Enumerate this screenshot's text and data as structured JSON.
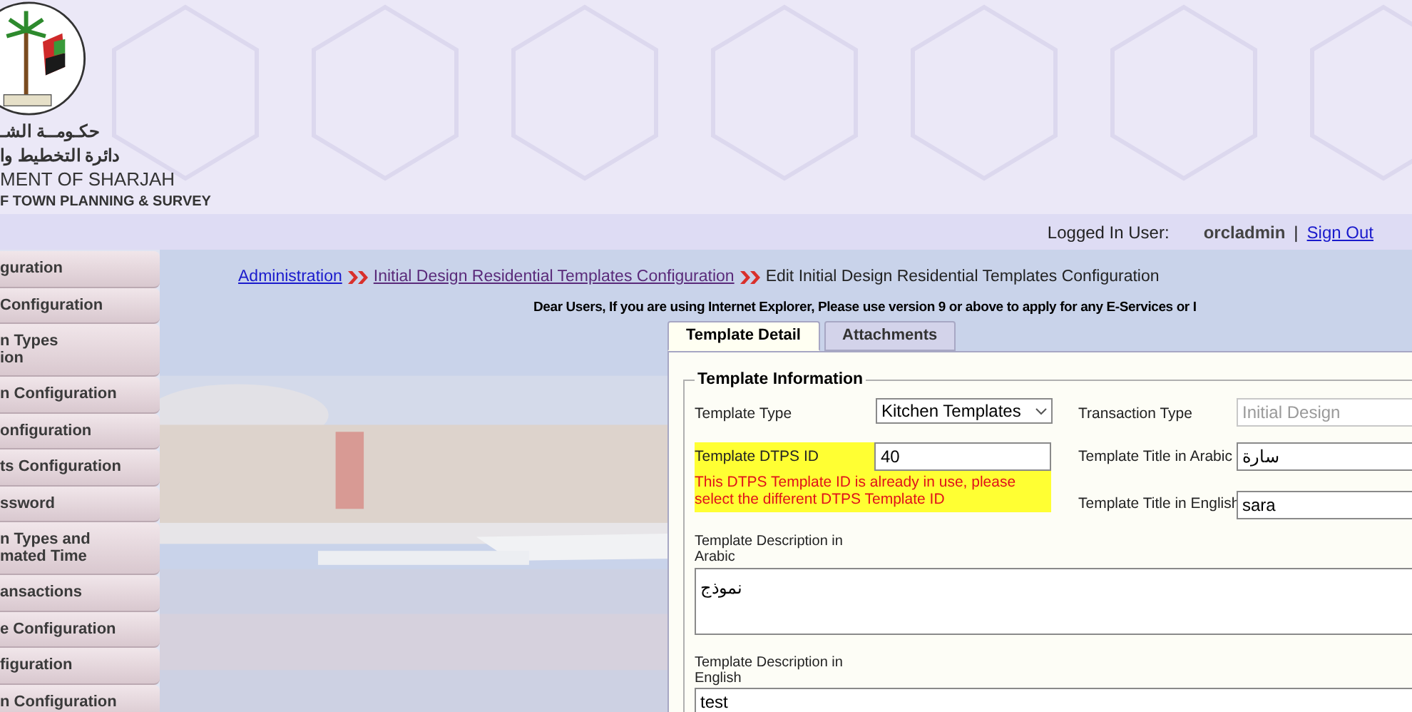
{
  "header": {
    "arabic_lines": [
      "حكـومــة الشـ",
      "دائرة التخطيط وا"
    ],
    "english_lines": [
      "MENT OF SHARJAH",
      "F TOWN PLANNING & SURVEY"
    ]
  },
  "user_bar": {
    "label": "Logged In User:",
    "user": "orcladmin",
    "separator": "|",
    "link": "Sign Out"
  },
  "sidebar": {
    "items": [
      {
        "lines": [
          "guration"
        ]
      },
      {
        "lines": [
          "Configuration"
        ]
      },
      {
        "lines": [
          "n Types",
          "ion"
        ]
      },
      {
        "lines": [
          "n Configuration"
        ]
      },
      {
        "lines": [
          "onfiguration"
        ]
      },
      {
        "lines": [
          "ts Configuration"
        ]
      },
      {
        "lines": [
          "ssword"
        ]
      },
      {
        "lines": [
          "n Types and",
          "mated Time"
        ]
      },
      {
        "lines": [
          "ansactions"
        ]
      },
      {
        "lines": [
          "e Configuration"
        ]
      },
      {
        "lines": [
          "figuration"
        ]
      },
      {
        "lines": [
          "n Configuration"
        ]
      }
    ]
  },
  "breadcrumb": [
    {
      "kind": "link",
      "label": "Administration"
    },
    {
      "kind": "link",
      "label": "Initial Design Residential Templates Configuration"
    },
    {
      "kind": "current",
      "label": "Edit Initial Design Residential Templates Configuration"
    }
  ],
  "notice": "Dear Users, If you are using Internet Explorer, Please use version 9 or above to apply for any E-Services or I",
  "tabs": [
    {
      "label": "Template Detail",
      "selected": true
    },
    {
      "label": "Attachments",
      "selected": false
    }
  ],
  "form": {
    "legend": "Template Information",
    "template_type": {
      "label": "Template Type",
      "value": "Kitchen Templates"
    },
    "transaction_type": {
      "label": "Transaction Type",
      "value": "Initial Design",
      "disabled": true
    },
    "dtps_id": {
      "label": "Template DTPS ID",
      "value": "40",
      "error": "This DTPS Template ID is already in use, please select the different DTPS Template ID",
      "highlighted": true
    },
    "title_arabic": {
      "label": "Template Title in Arabic",
      "value": "سارة"
    },
    "title_english": {
      "label": "Template Title in English",
      "value": "sara"
    },
    "desc_arabic": {
      "label": "Template Description in Arabic",
      "value": "نموذج"
    },
    "desc_english": {
      "label": "Template Description in English",
      "value": "test"
    }
  }
}
